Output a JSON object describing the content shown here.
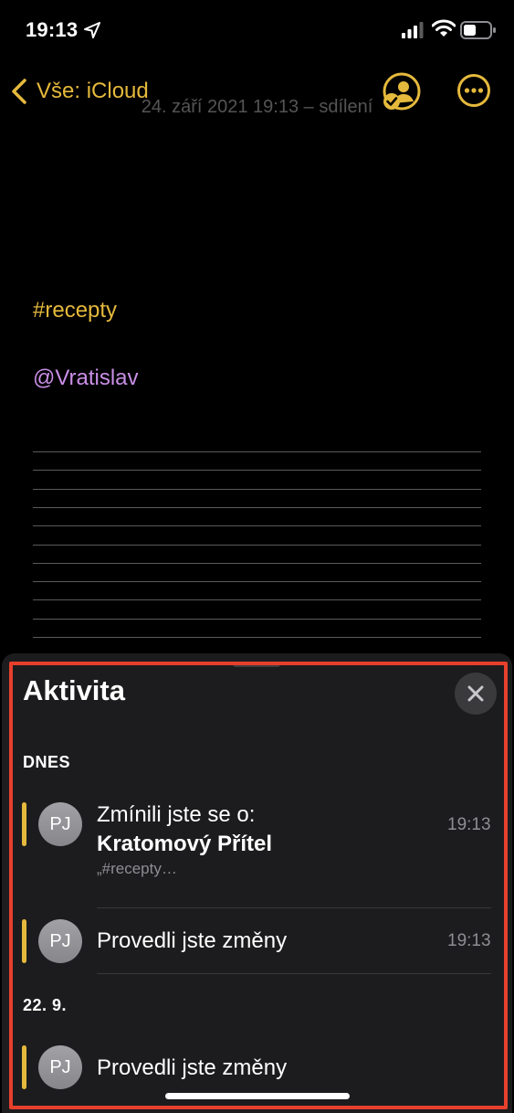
{
  "status_bar": {
    "time": "19:13",
    "icons": [
      "location-arrow-icon",
      "signal-icon",
      "wifi-icon",
      "battery-icon"
    ]
  },
  "nav": {
    "back_label": "Vše: iCloud",
    "subtitle": "24. září 2021 19:13 – sdílení",
    "collaboration_icon": "person-checkmark-icon",
    "more_icon": "ellipsis-circle-icon",
    "accent_color": "#e5b93c"
  },
  "note": {
    "tag": "#recepty",
    "mention": "@Vratislav",
    "tag_color": "#e5b93c",
    "mention_color": "#c98ee6"
  },
  "activity": {
    "title": "Aktivita",
    "close_icon": "close-icon",
    "sections": [
      {
        "label": "DNES",
        "items": [
          {
            "avatar": "PJ",
            "title_line1": "Zmínili jste se o:",
            "title_line2": "Kratomový Přítel",
            "subtitle": "„#recepty…",
            "time": "19:13"
          },
          {
            "avatar": "PJ",
            "title": "Provedli jste změny",
            "time": "19:13"
          }
        ]
      },
      {
        "label": "22. 9.",
        "items": [
          {
            "avatar": "PJ",
            "title": "Provedli jste změny"
          }
        ]
      }
    ],
    "highlight_color": "#e6402c"
  }
}
